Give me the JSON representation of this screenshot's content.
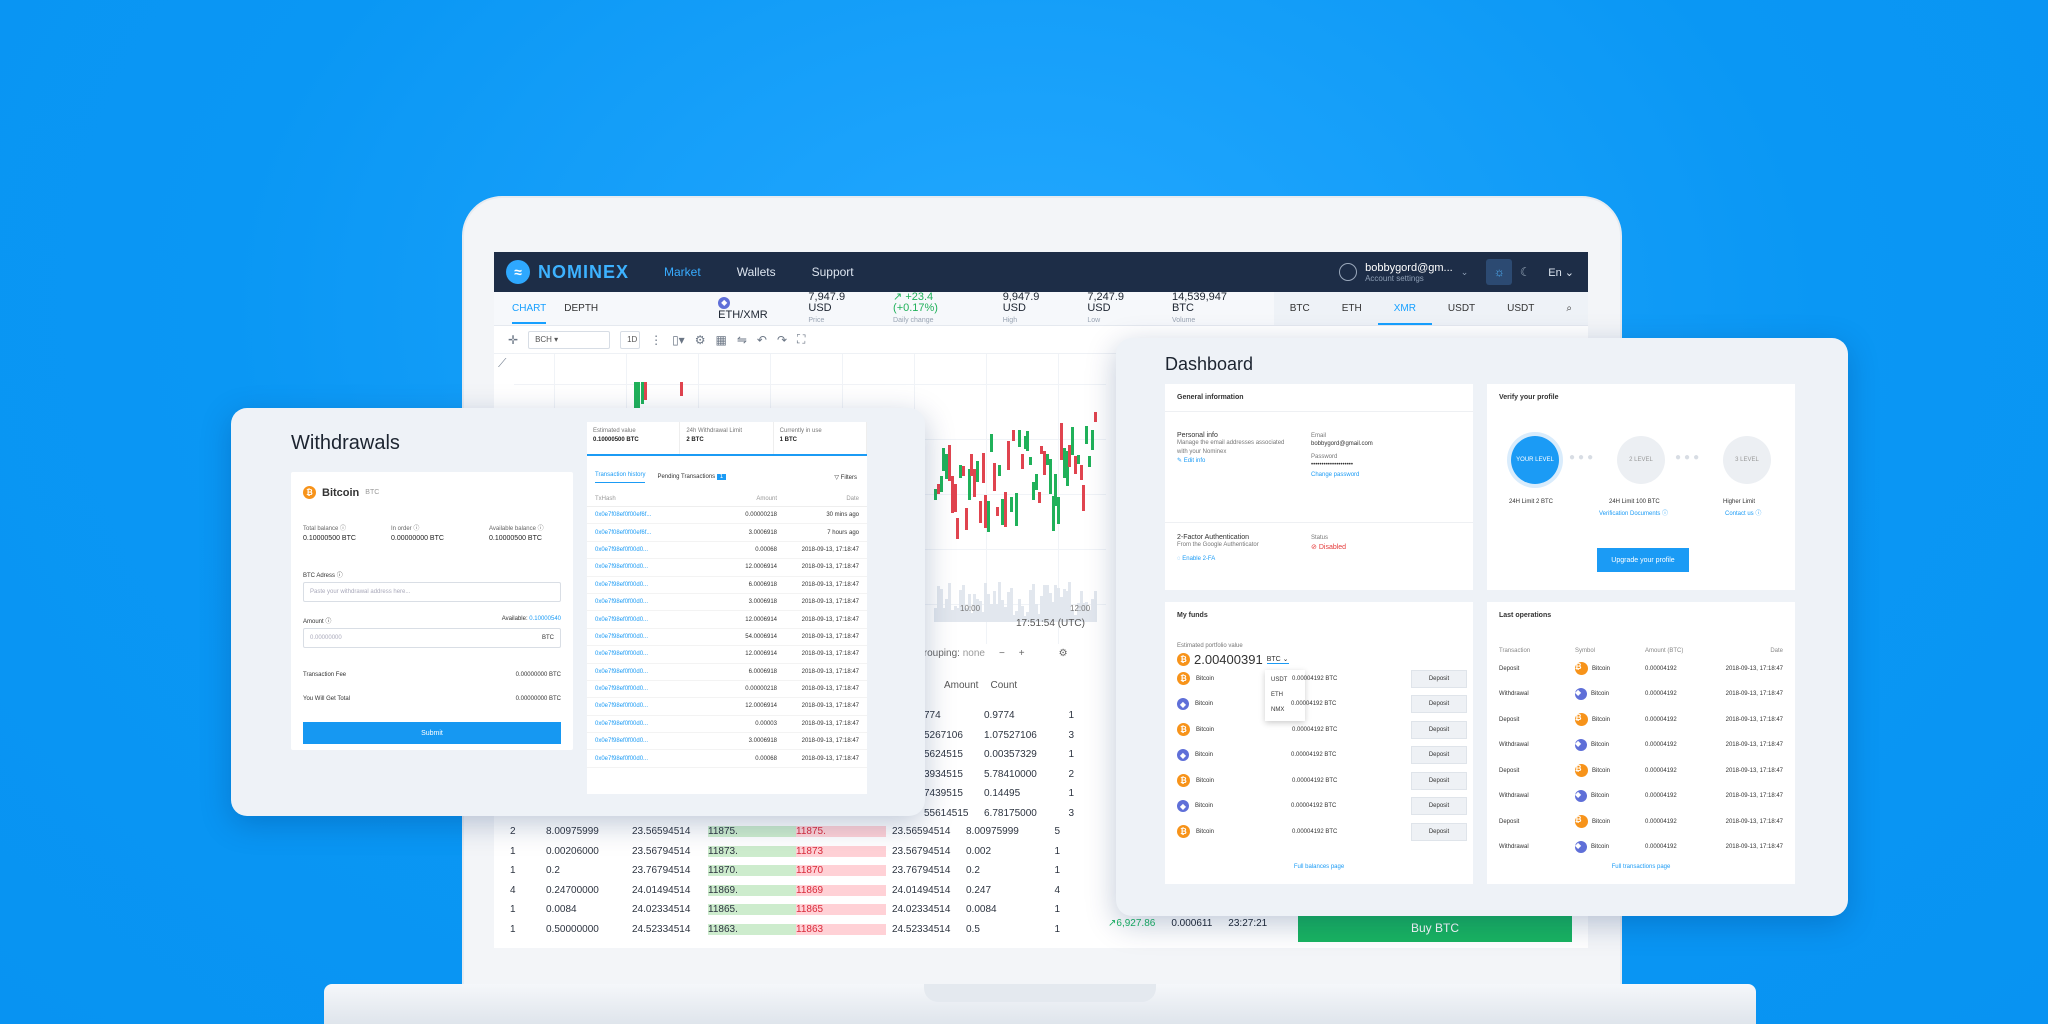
{
  "app": {
    "logo_text": "NOMINEX",
    "nav": [
      "Market",
      "Wallets",
      "Support"
    ],
    "user_name": "bobbygord@gm...",
    "user_sub": "Account settings",
    "lang": "En"
  },
  "ticker": {
    "tabs": [
      "CHART",
      "DEPTH"
    ],
    "pair": "ETH/XMR",
    "stats": [
      {
        "value": "7,947.9 USD",
        "label": "Price"
      },
      {
        "value": "+23.4 (+0.17%)",
        "label": "Daily change"
      },
      {
        "value": "9,947.9 USD",
        "label": "High"
      },
      {
        "value": "7,247.9 USD",
        "label": "Low"
      },
      {
        "value": "14,539,947 BTC",
        "label": "Volume"
      }
    ],
    "coins": [
      "BTC",
      "ETH",
      "XMR",
      "USDT",
      "USDT"
    ],
    "active_coin": "XMR"
  },
  "chart": {
    "toolbar_select": "BCH",
    "toolbar_interval": "1D",
    "time_labels": [
      "10:00",
      "12:00"
    ],
    "timestamp": "17:51:54 (UTC)"
  },
  "book": {
    "grouping_label": "Grouping:",
    "grouping_value": "none",
    "headers": [
      "Amount",
      "Count"
    ],
    "top_rows": [
      {
        "a": "774",
        "b": "0.9774",
        "c": "1"
      },
      {
        "a": "5267106",
        "b": "1.07527106",
        "c": "3"
      },
      {
        "a": "5624515",
        "b": "0.00357329",
        "c": "1"
      },
      {
        "a": "3934515",
        "b": "5.78410000",
        "c": "2"
      },
      {
        "a": "7439515",
        "b": "0.14495",
        "c": "1"
      },
      {
        "a": "55614515",
        "b": "6.78175000",
        "c": "3"
      }
    ],
    "rows": [
      {
        "c": "2",
        "v": "8.00975999",
        "t": "23.56594514",
        "p": "11875.",
        "q": "11875.",
        "t2": "23.56594514",
        "v2": "8.00975999",
        "c2": "5"
      },
      {
        "c": "1",
        "v": "0.00206000",
        "t": "23.56794514",
        "p": "11873.",
        "q": "11873",
        "t2": "23.56794514",
        "v2": "0.002",
        "c2": "1"
      },
      {
        "c": "1",
        "v": "0.2",
        "t": "23.76794514",
        "p": "11870.",
        "q": "11870",
        "t2": "23.76794514",
        "v2": "0.2",
        "c2": "1"
      },
      {
        "c": "4",
        "v": "0.24700000",
        "t": "24.01494514",
        "p": "11869.",
        "q": "11869",
        "t2": "24.01494514",
        "v2": "0.247",
        "c2": "4"
      },
      {
        "c": "1",
        "v": "0.0084",
        "t": "24.02334514",
        "p": "11865.",
        "q": "11865",
        "t2": "24.02334514",
        "v2": "0.0084",
        "c2": "1"
      },
      {
        "c": "1",
        "v": "0.50000000",
        "t": "24.52334514",
        "p": "11863.",
        "q": "11863",
        "t2": "24.52334514",
        "v2": "0.5",
        "c2": "1"
      }
    ],
    "trade_price": "6,927.86",
    "trade_amount": "0.000611",
    "trade_time": "23:27:21",
    "buy_label": "Buy BTC"
  },
  "withdrawals": {
    "title": "Withdrawals",
    "coin": "Bitcoin",
    "coin_sym": "BTC",
    "balances": [
      {
        "label": "Total balance",
        "value": "0.10000500 BTC"
      },
      {
        "label": "In order",
        "value": "0.00000000 BTC"
      },
      {
        "label": "Available balance",
        "value": "0.10000500 BTC"
      }
    ],
    "address_label": "BTC Adress",
    "address_placeholder": "Paste your withdrawal address here...",
    "amount_label": "Amount",
    "available_label": "Available:",
    "available_value": "0.10000540",
    "amount_placeholder": "0.00000000",
    "amount_unit": "BTC",
    "fee_label": "Transaction Fee",
    "fee_value": "0.00000000 BTC",
    "total_label": "You Will Get Total",
    "total_value": "0.00000000 BTC",
    "submit": "Submit",
    "stats": [
      {
        "label": "Estimated value",
        "value": "0.10000500 BTC"
      },
      {
        "label": "24h Withdrawal Limit",
        "value": "2 BTC"
      },
      {
        "label": "Currently in use",
        "value": "1 BTC"
      }
    ],
    "tabs": [
      "Transaction history",
      "Pending Transactions"
    ],
    "pending_count": "1",
    "filters": "Filters",
    "head": [
      "TxHash",
      "Amount",
      "Date"
    ],
    "txs": [
      {
        "h": "0x0e7f08ef0f00ef6f...",
        "a": "0.00000218",
        "d": "30 mins ago"
      },
      {
        "h": "0x0e7f08ef0f00ef6f...",
        "a": "3.0006918",
        "d": "7 hours ago"
      },
      {
        "h": "0x0e7f98ef0f00d0...",
        "a": "0.00068",
        "d": "2018-09-13, 17:18:47"
      },
      {
        "h": "0x0e7f98ef0f00d0...",
        "a": "12.0006914",
        "d": "2018-09-13, 17:18:47"
      },
      {
        "h": "0x0e7f98ef0f00d0...",
        "a": "6.0006918",
        "d": "2018-09-13, 17:18:47"
      },
      {
        "h": "0x0e7f98ef0f00d0...",
        "a": "3.0006918",
        "d": "2018-09-13, 17:18:47"
      },
      {
        "h": "0x0e7f98ef0f00d0...",
        "a": "12.0006914",
        "d": "2018-09-13, 17:18:47"
      },
      {
        "h": "0x0e7f98ef0f00d0...",
        "a": "54.0006914",
        "d": "2018-09-13, 17:18:47"
      },
      {
        "h": "0x0e7f98ef0f00d0...",
        "a": "12.0006914",
        "d": "2018-09-13, 17:18:47"
      },
      {
        "h": "0x0e7f98ef0f00d0...",
        "a": "6.0006918",
        "d": "2018-09-13, 17:18:47"
      },
      {
        "h": "0x0e7f98ef0f00d0...",
        "a": "0.00000218",
        "d": "2018-09-13, 17:18:47"
      },
      {
        "h": "0x0e7f98ef0f00d0...",
        "a": "12.0006914",
        "d": "2018-09-13, 17:18:47"
      },
      {
        "h": "0x0e7f98ef0f00d0...",
        "a": "0.00003",
        "d": "2018-09-13, 17:18:47"
      },
      {
        "h": "0x0e7f98ef0f00d0...",
        "a": "3.0006918",
        "d": "2018-09-13, 17:18:47"
      },
      {
        "h": "0x0e7f98ef0f00d0...",
        "a": "0.00068",
        "d": "2018-09-13, 17:18:47"
      }
    ]
  },
  "dashboard": {
    "title": "Dashboard",
    "general_title": "General information",
    "personal_title": "Personal info",
    "personal_desc": "Manage the email addresses associated with your Nominex",
    "edit_info": "Edit info",
    "email_label": "Email",
    "email_value": "bobbygord@gmail.com",
    "password_label": "Password",
    "password_value": "••••••••••••••••••••",
    "change_password": "Change password",
    "twofa_title": "2-Factor Authentication",
    "twofa_desc": "From the Google Authenticator",
    "enable_2fa": "Enable 2-FA",
    "status_label": "Status",
    "status_value": "Disabled",
    "verify_title": "Verify your profile",
    "levels": [
      "YOUR LEVEL",
      "2 LEVEL",
      "3 LEVEL"
    ],
    "limits": [
      "24H Limit 2 BTC",
      "24H Limit 100 BTC",
      "Higher Limit"
    ],
    "verify_links": [
      "Verification Documents",
      "Contact us"
    ],
    "upgrade": "Upgrade your profile",
    "funds_title": "My funds",
    "est_label": "Estimated portfolio value",
    "est_value": "2.00400391",
    "est_unit": "BTC",
    "dropdown": [
      "USDT",
      "ETH",
      "NMX"
    ],
    "funds": [
      {
        "icon": "btc",
        "name": "Bitcoin",
        "amount": "0.00004192 BTC",
        "btn": "Deposit"
      },
      {
        "icon": "eth",
        "name": "Bitcoin",
        "amount": "0.00004192 BTC",
        "btn": "Deposit"
      },
      {
        "icon": "btc",
        "name": "Bitcoin",
        "amount": "0.00004192 BTC",
        "btn": "Deposit"
      },
      {
        "icon": "eth",
        "name": "Bitcoin",
        "amount": "0.00004192 BTC",
        "btn": "Deposit"
      },
      {
        "icon": "btc",
        "name": "Bitcoin",
        "amount": "0.00004192 BTC",
        "btn": "Deposit"
      },
      {
        "icon": "eth",
        "name": "Bitcoin",
        "amount": "0.00004192 BTC",
        "btn": "Deposit"
      },
      {
        "icon": "btc",
        "name": "Bitcoin",
        "amount": "0.00004192 BTC",
        "btn": "Deposit"
      }
    ],
    "full_balances": "Full balances page",
    "ops_title": "Last operations",
    "ops_head": [
      "Transaction",
      "Symbol",
      "Amount (BTC)",
      "Date"
    ],
    "ops": [
      {
        "t": "Deposit",
        "icon": "btc",
        "s": "Bitcoin",
        "a": "0.00004192",
        "d": "2018-09-13, 17:18:47"
      },
      {
        "t": "Withdrawal",
        "icon": "eth",
        "s": "Bitcoin",
        "a": "0.00004192",
        "d": "2018-09-13, 17:18:47"
      },
      {
        "t": "Deposit",
        "icon": "btc",
        "s": "Bitcoin",
        "a": "0.00004192",
        "d": "2018-09-13, 17:18:47"
      },
      {
        "t": "Withdrawal",
        "icon": "eth",
        "s": "Bitcoin",
        "a": "0.00004192",
        "d": "2018-09-13, 17:18:47"
      },
      {
        "t": "Deposit",
        "icon": "btc",
        "s": "Bitcoin",
        "a": "0.00004192",
        "d": "2018-09-13, 17:18:47"
      },
      {
        "t": "Withdrawal",
        "icon": "eth",
        "s": "Bitcoin",
        "a": "0.00004192",
        "d": "2018-09-13, 17:18:47"
      },
      {
        "t": "Deposit",
        "icon": "btc",
        "s": "Bitcoin",
        "a": "0.00004192",
        "d": "2018-09-13, 17:18:47"
      },
      {
        "t": "Withdrawal",
        "icon": "eth",
        "s": "Bitcoin",
        "a": "0.00004192",
        "d": "2018-09-13, 17:18:47"
      }
    ],
    "full_transactions": "Full transactions page"
  },
  "colors": {
    "background": "#0d9bf7",
    "nav": "#1d2d47",
    "accent": "#1b9bf5",
    "buy": "#19b461",
    "sell": "#d92b3b"
  }
}
